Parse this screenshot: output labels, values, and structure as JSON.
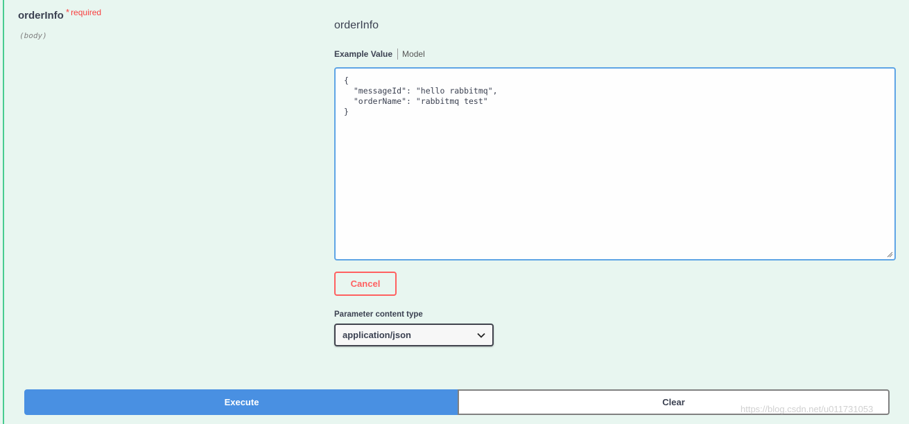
{
  "parameter": {
    "name": "orderInfo",
    "required_star": "*",
    "required_label": "required",
    "location": "(body)"
  },
  "body_section": {
    "title": "orderInfo",
    "tabs": {
      "example_value": "Example Value",
      "model": "Model"
    },
    "code": "{\n  \"messageId\": \"hello rabbitmq\",\n  \"orderName\": \"rabbitmq test\"\n}"
  },
  "cancel_label": "Cancel",
  "content_type": {
    "label": "Parameter content type",
    "selected": "application/json",
    "icon": "chevron-down-icon"
  },
  "actions": {
    "execute_label": "Execute",
    "clear_label": "Clear"
  },
  "watermark": "https://blog.csdn.net/u011731053",
  "colors": {
    "background": "#e8f6f0",
    "accent_green": "#49cc90",
    "required_red": "#f93e3e",
    "cancel_red": "#ff6060",
    "execute_blue": "#4990e2",
    "textarea_border": "#5ea4e5"
  }
}
